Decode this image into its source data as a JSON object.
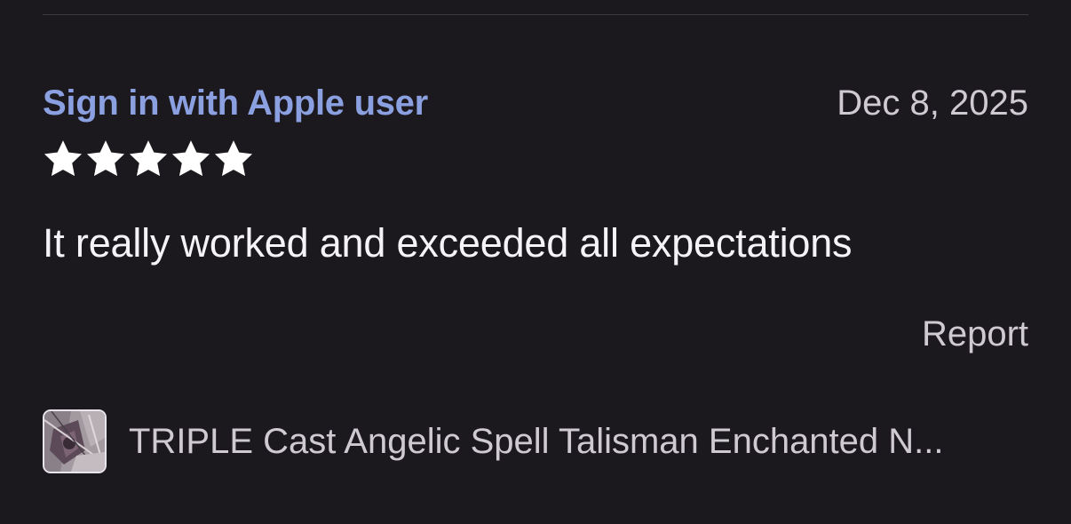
{
  "review": {
    "reviewer": "Sign in with Apple user",
    "date": "Dec 8, 2025",
    "rating": 5,
    "rating_max": 5,
    "text": "It really worked and exceeded all expectations",
    "report_label": "Report"
  },
  "product": {
    "title": "TRIPLE Cast Angelic Spell Talisman Enchanted N...",
    "thumbnail_icon": "product-thumbnail-image"
  },
  "colors": {
    "background": "#1c191e",
    "reviewer_accent": "#8ba0e0",
    "secondary_text": "#cfc9d2",
    "primary_text": "#f5f3f7",
    "star": "#ffffff"
  }
}
